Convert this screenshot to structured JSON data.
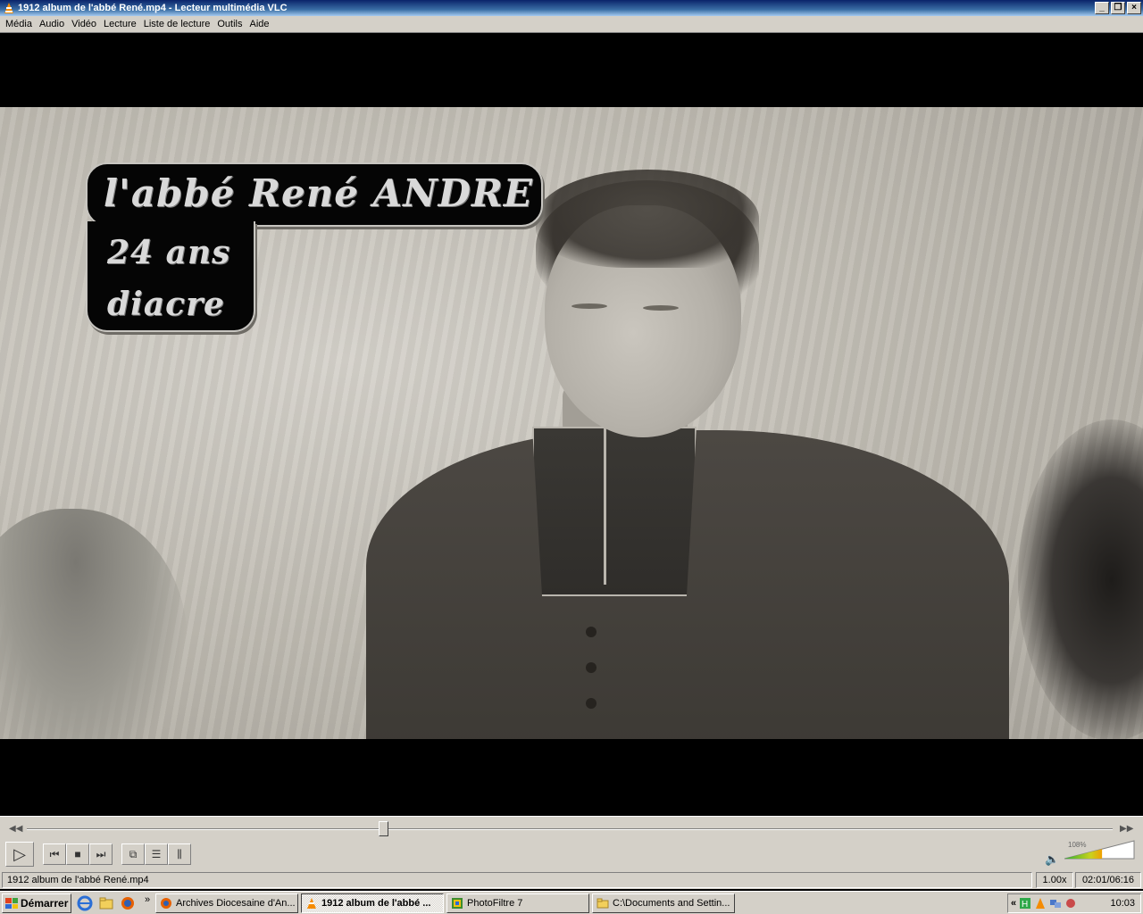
{
  "window": {
    "title": "1912 album de l'abbé René.mp4 - Lecteur multimédia VLC",
    "controls": {
      "minimize": "_",
      "maximize": "❐",
      "close": "×"
    }
  },
  "menu": [
    "Média",
    "Audio",
    "Vidéo",
    "Lecture",
    "Liste de lecture",
    "Outils",
    "Aide"
  ],
  "video": {
    "caption_line1": "l'abbé René ANDRE",
    "caption_line2": "24 ans",
    "caption_line3": "diacre"
  },
  "playback": {
    "position_fraction": 0.3288,
    "volume_label": "108%",
    "volume_fraction": 1.08
  },
  "icons": [
    "play-icon",
    "previous-icon",
    "stop-icon",
    "next-icon",
    "fullscreen-icon",
    "playlist-icon",
    "equalizer-icon",
    "volume-icon"
  ],
  "status": {
    "file": "1912 album de l'abbé René.mp4",
    "speed": "1.00x",
    "time": "02:01/06:16"
  },
  "taskbar": {
    "start_label": "Démarrer",
    "tasks": [
      {
        "label": "Archives Diocesaine d'An...",
        "icon": "firefox-icon",
        "active": false
      },
      {
        "label": "1912 album de l'abbé ...",
        "icon": "vlc-icon",
        "active": true
      },
      {
        "label": "PhotoFiltre 7",
        "icon": "photofiltre-icon",
        "active": false
      },
      {
        "label": "C:\\Documents and Settin...",
        "icon": "folder-icon",
        "active": false
      }
    ],
    "clock": "10:03",
    "colors": {
      "start_green": "#3c8d2f",
      "taskbar": "#d4d0c8"
    }
  }
}
